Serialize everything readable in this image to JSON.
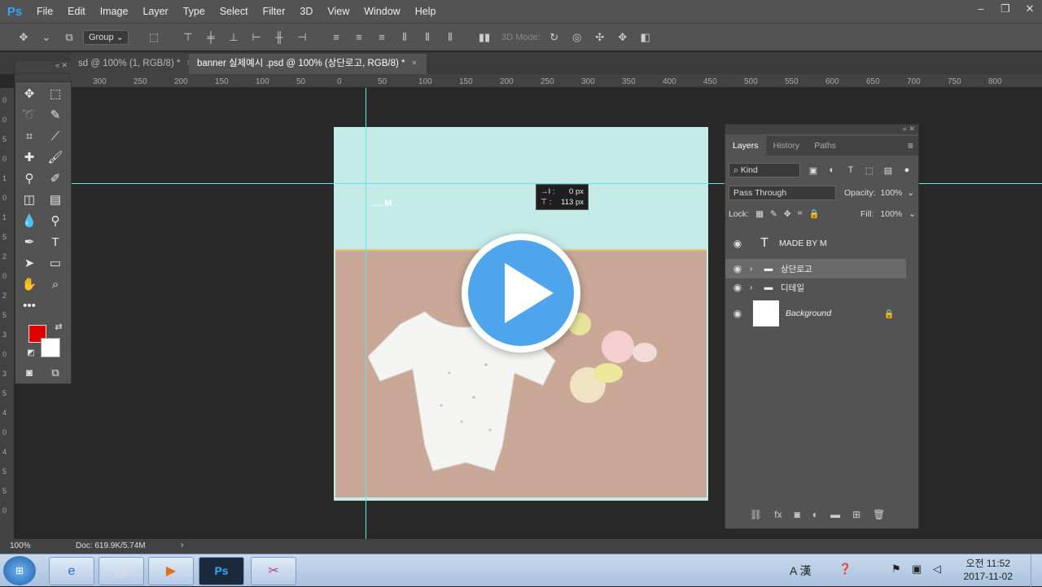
{
  "app": {
    "logo": "Ps"
  },
  "menu": [
    "File",
    "Edit",
    "Image",
    "Layer",
    "Type",
    "Select",
    "Filter",
    "3D",
    "View",
    "Window",
    "Help"
  ],
  "options": {
    "group_select": "Group",
    "mode_3d": "3D Mode:"
  },
  "tabs": [
    {
      "label": "sd @ 100% (1, RGB/8) *",
      "close": "×"
    },
    {
      "label": "banner 실제예시 .psd @ 100% (상단로고, RGB/8) *",
      "close": "×"
    }
  ],
  "ruler_h": [
    "300",
    "250",
    "200",
    "150",
    "100",
    "50",
    "0",
    "50",
    "100",
    "150",
    "200",
    "250",
    "300",
    "350",
    "400",
    "450",
    "500",
    "550",
    "600",
    "650",
    "700",
    "750",
    "800"
  ],
  "ruler_v": [
    "0",
    "0",
    "5",
    "0",
    "1",
    "0",
    "1",
    "5",
    "2",
    "0",
    "2",
    "5",
    "3",
    "0",
    "3",
    "5",
    "4",
    "0",
    "4",
    "5",
    "5",
    "0"
  ],
  "canvas": {
    "logo_text": "....M"
  },
  "measure_tooltip": {
    "dx_label": "→I :",
    "dx_value": "0 px",
    "dy_label": "⊤ :",
    "dy_value": "113 px"
  },
  "layers_panel": {
    "tabs": [
      "Layers",
      "History",
      "Paths"
    ],
    "kind": "Kind",
    "blend_mode": "Pass Through",
    "opacity_label": "Opacity:",
    "opacity_value": "100%",
    "lock_label": "Lock:",
    "fill_label": "Fill:",
    "fill_value": "100%",
    "layers": [
      {
        "name": "MADE BY M",
        "type": "text"
      },
      {
        "name": "상단로고",
        "type": "group"
      },
      {
        "name": "디테일",
        "type": "group"
      },
      {
        "name": "Background",
        "type": "background"
      }
    ]
  },
  "status": {
    "zoom": "100%",
    "doc": "Doc: 619.9K/5.74M"
  },
  "taskbar": {
    "clock_time": "오전 11:52",
    "clock_date": "2017-11-02",
    "ime": "A 漢"
  }
}
